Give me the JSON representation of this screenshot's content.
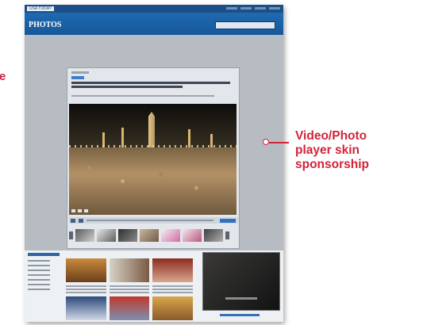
{
  "colors": {
    "accent_red": "#d2233a",
    "header_blue": "#1f6ab0",
    "page_gray": "#b7bcc3"
  },
  "left_fragment": "e",
  "site": {
    "brand": "USA TODAY",
    "section_title": "PHOTOS"
  },
  "callout": {
    "lines": [
      "Video/Photo",
      "player skin",
      "sponsorship"
    ]
  }
}
